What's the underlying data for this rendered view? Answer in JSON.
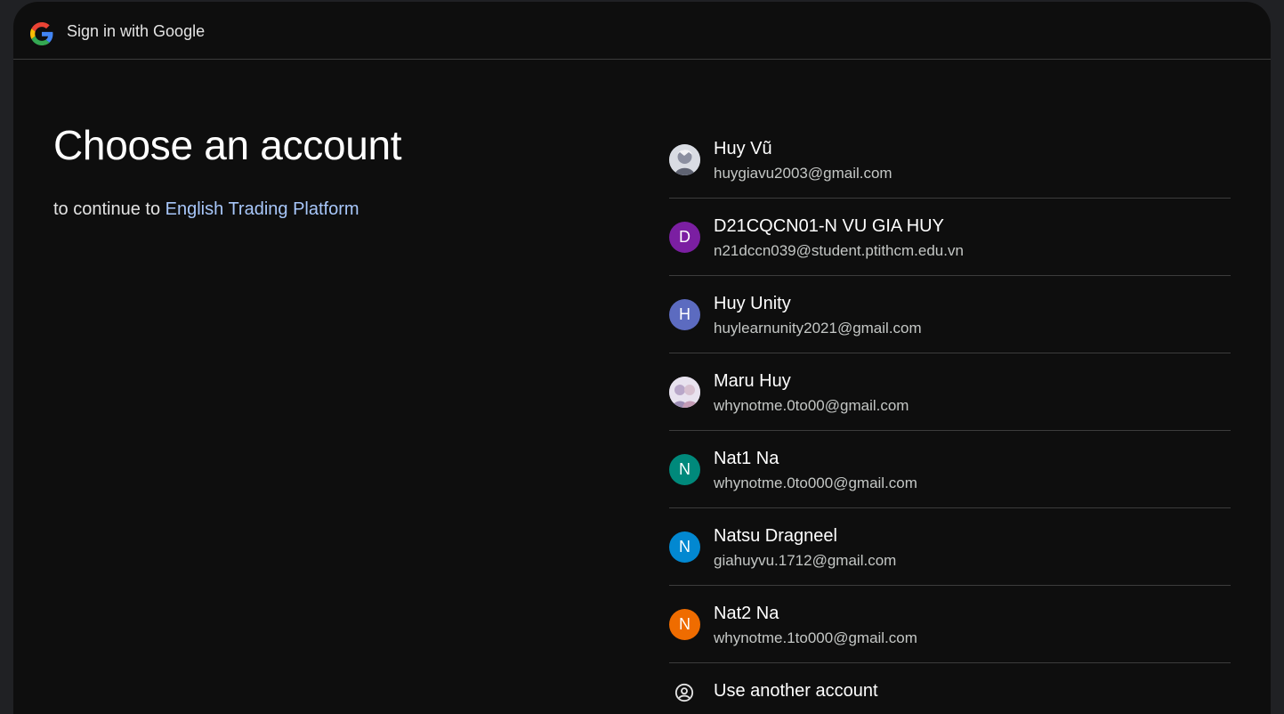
{
  "header": {
    "title": "Sign in with Google",
    "logo_icon": "google-g-icon"
  },
  "main": {
    "heading": "Choose an account",
    "subtitle_prefix": "to continue to ",
    "app_name": "English Trading Platform"
  },
  "accounts": [
    {
      "name": "Huy Vũ",
      "email": "huygiavu2003@gmail.com",
      "avatar_type": "photo",
      "avatar_icon": "profile-photo-icon",
      "avatar_color": "#9aa0ab"
    },
    {
      "name": "D21CQCN01-N VU GIA HUY",
      "email": "n21dccn039@student.ptithcm.edu.vn",
      "avatar_type": "letter",
      "avatar_letter": "D",
      "avatar_color": "#7b1fa2"
    },
    {
      "name": "Huy Unity",
      "email": "huylearnunity2021@gmail.com",
      "avatar_type": "letter",
      "avatar_letter": "H",
      "avatar_color": "#5c6bc0"
    },
    {
      "name": "Maru Huy",
      "email": "whynotme.0to00@gmail.com",
      "avatar_type": "photo",
      "avatar_icon": "profile-photo-icon",
      "avatar_color": "#c9c3d6"
    },
    {
      "name": "Nat1 Na",
      "email": "whynotme.0to000@gmail.com",
      "avatar_type": "letter",
      "avatar_letter": "N",
      "avatar_color": "#00897b"
    },
    {
      "name": "Natsu Dragneel",
      "email": "giahuyvu.1712@gmail.com",
      "avatar_type": "letter",
      "avatar_letter": "N",
      "avatar_color": "#0288d1"
    },
    {
      "name": "Nat2 Na",
      "email": "whynotme.1to000@gmail.com",
      "avatar_type": "letter",
      "avatar_letter": "N",
      "avatar_color": "#ef6c00"
    }
  ],
  "use_another": {
    "label": "Use another account",
    "icon": "account-circle-icon"
  },
  "colors": {
    "background": "#0e0e0e",
    "link": "#a8c7fa",
    "divider": "#3c3c3c"
  }
}
